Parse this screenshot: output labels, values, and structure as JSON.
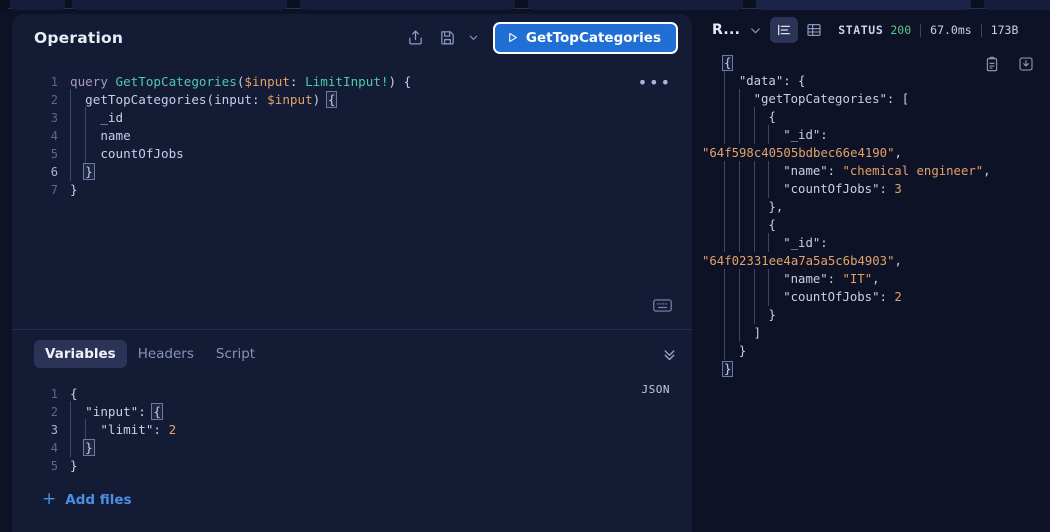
{
  "tabstrip": {
    "tabs": [
      "",
      "",
      "",
      "",
      "",
      ""
    ]
  },
  "operation": {
    "title": "Operation",
    "actions": {
      "share_icon": "share-icon",
      "save_icon": "save-icon",
      "save_chevron_icon": "chevron-down-icon",
      "more_icon": "more-horizontal-icon",
      "keyboard_icon": "keyboard-icon"
    },
    "run_button": {
      "label": "GetTopCategories",
      "icon": "play-icon",
      "background": "#1f6fd4",
      "border": "#ffffff"
    },
    "code": {
      "language": "graphql",
      "lines": [
        {
          "n": "1",
          "segments": [
            {
              "t": "query ",
              "c": "kw"
            },
            {
              "t": "GetTopCategories",
              "c": "def"
            },
            {
              "t": "(",
              "c": "pun"
            },
            {
              "t": "$input",
              "c": "var"
            },
            {
              "t": ": ",
              "c": "pun"
            },
            {
              "t": "LimitInput!",
              "c": "def"
            },
            {
              "t": ") {",
              "c": "pun"
            }
          ]
        },
        {
          "n": "2",
          "indent": 1,
          "segments": [
            {
              "t": "getTopCategories",
              "c": "fld"
            },
            {
              "t": "(input: ",
              "c": "pun"
            },
            {
              "t": "$input",
              "c": "var"
            },
            {
              "t": ") ",
              "c": "pun"
            },
            {
              "t": "{",
              "c": "pun hl"
            }
          ]
        },
        {
          "n": "3",
          "indent": 2,
          "segments": [
            {
              "t": "_id",
              "c": "fld"
            }
          ]
        },
        {
          "n": "4",
          "indent": 2,
          "segments": [
            {
              "t": "name",
              "c": "fld"
            }
          ]
        },
        {
          "n": "5",
          "indent": 2,
          "segments": [
            {
              "t": "countOfJobs",
              "c": "fld"
            }
          ]
        },
        {
          "n": "6",
          "indent": 1,
          "segments": [
            {
              "t": "}",
              "c": "pun hl"
            }
          ]
        },
        {
          "n": "7",
          "indent": 0,
          "segments": [
            {
              "t": "}",
              "c": "pun"
            }
          ]
        }
      ]
    }
  },
  "variables": {
    "tabs": [
      {
        "label": "Variables",
        "active": true
      },
      {
        "label": "Headers",
        "active": false
      },
      {
        "label": "Script",
        "active": false
      }
    ],
    "collapse_icon": "chevrons-down-icon",
    "format_label": "JSON",
    "code": {
      "lines": [
        {
          "n": "1",
          "indent": 0,
          "segments": [
            {
              "t": "{",
              "c": "jpun"
            }
          ]
        },
        {
          "n": "2",
          "indent": 1,
          "segments": [
            {
              "t": "\"input\"",
              "c": "jkey"
            },
            {
              "t": ": ",
              "c": "jpun"
            },
            {
              "t": "{",
              "c": "jpun hl"
            }
          ]
        },
        {
          "n": "3",
          "indent": 2,
          "segments": [
            {
              "t": "\"limit\"",
              "c": "jkey"
            },
            {
              "t": ": ",
              "c": "jpun"
            },
            {
              "t": "2",
              "c": "jnum"
            }
          ]
        },
        {
          "n": "4",
          "indent": 1,
          "segments": [
            {
              "t": "}",
              "c": "jpun hl"
            }
          ]
        },
        {
          "n": "5",
          "indent": 0,
          "segments": [
            {
              "t": "}",
              "c": "jpun"
            }
          ]
        }
      ]
    },
    "add_files": {
      "label": "Add files",
      "icon": "plus-icon"
    }
  },
  "response": {
    "title": "R...",
    "title_chevron_icon": "chevron-down-icon",
    "view_modes": [
      {
        "name": "lines-view",
        "icon": "lines-icon",
        "active": true
      },
      {
        "name": "table-view",
        "icon": "table-icon",
        "active": false
      }
    ],
    "status": {
      "label": "STATUS",
      "code": "200",
      "code_color": "#5fc38b",
      "time": "67.0ms",
      "size": "173B"
    },
    "actions": {
      "copy_icon": "clipboard-icon",
      "download_icon": "download-icon"
    },
    "json": {
      "lines": [
        {
          "indent": 0,
          "segments": [
            {
              "t": "{",
              "c": "jpun hl"
            }
          ]
        },
        {
          "indent": 1,
          "segments": [
            {
              "t": "\"data\"",
              "c": "jkey"
            },
            {
              "t": ": {",
              "c": "jpun"
            }
          ]
        },
        {
          "indent": 2,
          "segments": [
            {
              "t": "\"getTopCategories\"",
              "c": "jkey"
            },
            {
              "t": ": [",
              "c": "jpun"
            }
          ]
        },
        {
          "indent": 3,
          "segments": [
            {
              "t": "{",
              "c": "jpun"
            }
          ]
        },
        {
          "indent": 4,
          "segments": [
            {
              "t": "\"_id\"",
              "c": "jkey"
            },
            {
              "t": ":",
              "c": "jpun"
            }
          ]
        },
        {
          "indent": 0,
          "raw": true,
          "segments": [
            {
              "t": "\"64f598c40505bdbec66e4190\"",
              "c": "jstr"
            },
            {
              "t": ",",
              "c": "jpun"
            }
          ]
        },
        {
          "indent": 4,
          "segments": [
            {
              "t": "\"name\"",
              "c": "jkey"
            },
            {
              "t": ": ",
              "c": "jpun"
            },
            {
              "t": "\"chemical engineer\"",
              "c": "jstr"
            },
            {
              "t": ",",
              "c": "jpun"
            }
          ]
        },
        {
          "indent": 4,
          "segments": [
            {
              "t": "\"countOfJobs\"",
              "c": "jkey"
            },
            {
              "t": ": ",
              "c": "jpun"
            },
            {
              "t": "3",
              "c": "jnum"
            }
          ]
        },
        {
          "indent": 3,
          "segments": [
            {
              "t": "},",
              "c": "jpun"
            }
          ]
        },
        {
          "indent": 3,
          "segments": [
            {
              "t": "{",
              "c": "jpun"
            }
          ]
        },
        {
          "indent": 4,
          "segments": [
            {
              "t": "\"_id\"",
              "c": "jkey"
            },
            {
              "t": ":",
              "c": "jpun"
            }
          ]
        },
        {
          "indent": 0,
          "raw": true,
          "segments": [
            {
              "t": "\"64f02331ee4a7a5a5c6b4903\"",
              "c": "jstr"
            },
            {
              "t": ",",
              "c": "jpun"
            }
          ]
        },
        {
          "indent": 4,
          "segments": [
            {
              "t": "\"name\"",
              "c": "jkey"
            },
            {
              "t": ": ",
              "c": "jpun"
            },
            {
              "t": "\"IT\"",
              "c": "jstr"
            },
            {
              "t": ",",
              "c": "jpun"
            }
          ]
        },
        {
          "indent": 4,
          "segments": [
            {
              "t": "\"countOfJobs\"",
              "c": "jkey"
            },
            {
              "t": ": ",
              "c": "jpun"
            },
            {
              "t": "2",
              "c": "jnum"
            }
          ]
        },
        {
          "indent": 3,
          "segments": [
            {
              "t": "}",
              "c": "jpun"
            }
          ]
        },
        {
          "indent": 2,
          "segments": [
            {
              "t": "]",
              "c": "jpun"
            }
          ]
        },
        {
          "indent": 1,
          "segments": [
            {
              "t": "}",
              "c": "jpun"
            }
          ]
        },
        {
          "indent": 0,
          "segments": [
            {
              "t": "}",
              "c": "jpun hl"
            }
          ]
        }
      ]
    }
  }
}
